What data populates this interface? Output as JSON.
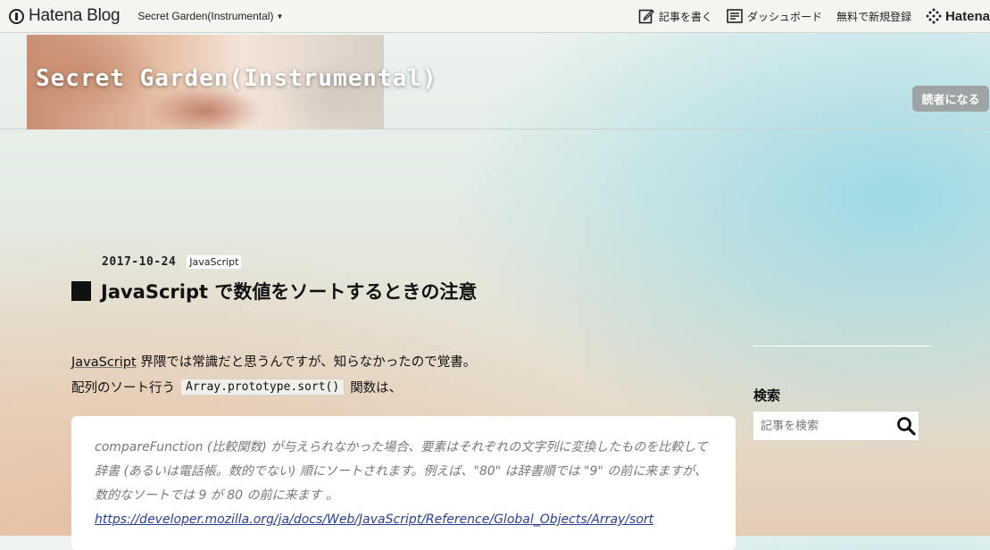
{
  "topbar": {
    "logo_text": "Hatena Blog",
    "blog_switcher": "Secret Garden(Instrumental)",
    "write_label": "記事を書く",
    "dashboard_label": "ダッシュボード",
    "register_label": "無料で新規登録",
    "brand_label": "Hatena"
  },
  "header": {
    "title": "Secret Garden(Instrumental)",
    "subscribe_label": "読者になる"
  },
  "article": {
    "date": "2017-10-24",
    "category": "JavaScript",
    "title": "JavaScript で数値をソートするときの注意",
    "line1_link": "JavaScript",
    "line1_rest": " 界隈では常識だと思うんですが、知らなかったので覚書。",
    "line2_before": "配列のソート行う",
    "line2_code": "Array.prototype.sort()",
    "line2_after": "関数は、",
    "quote_text": "compareFunction (比較関数) が与えられなかった場合、要素はそれぞれの文字列に変換したものを比較して辞書 (あるいは電話帳。数的でない) 順にソートされます。例えば、\"80\" は辞書順では \"9\" の前に来ますが、数的なソートでは 9 が 80 の前に来ます 。",
    "quote_link": "https://developer.mozilla.org/ja/docs/Web/JavaScript/Reference/Global_Objects/Array/sort"
  },
  "sidebar": {
    "search_heading": "検索",
    "search_placeholder": "記事を検索"
  },
  "colors": {
    "subscribe_bg": "#9ea4a6",
    "link_blue": "#2a3f9a",
    "topbar_bg": "#f4f4f0"
  }
}
